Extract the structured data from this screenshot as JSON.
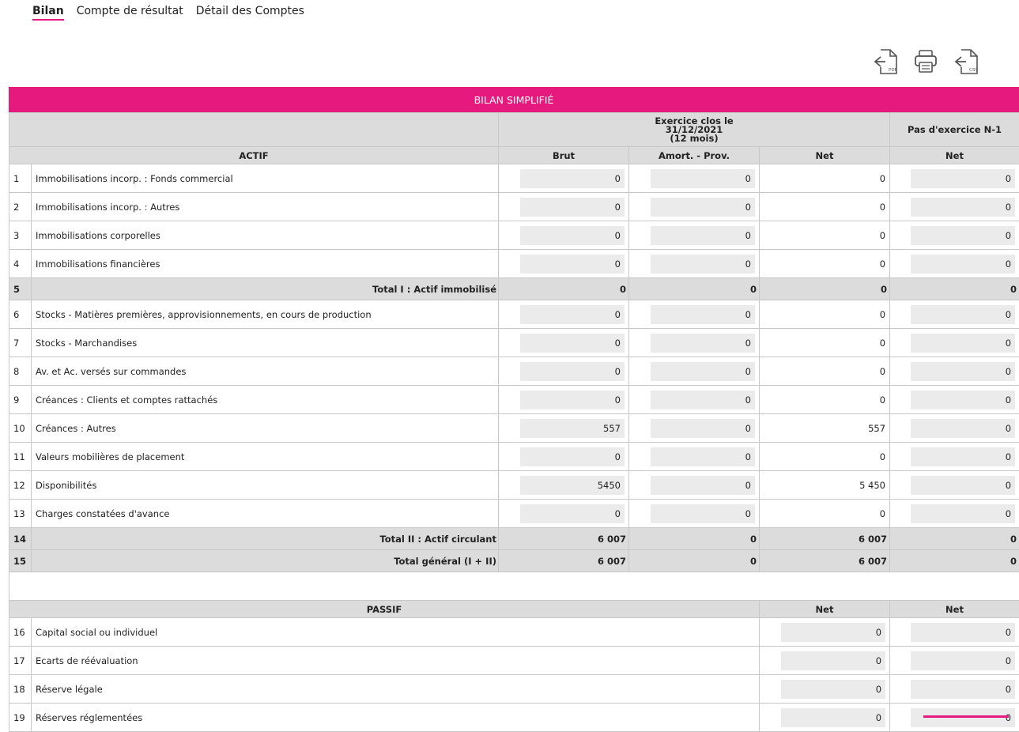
{
  "tabs": [
    {
      "label": "Bilan",
      "active": true
    },
    {
      "label": "Compte de résultat",
      "active": false
    },
    {
      "label": "Détail des Comptes",
      "active": false
    }
  ],
  "actions": {
    "pdf_label": "PDF",
    "csv_label": "CSV"
  },
  "colors": {
    "accent": "#e6197e",
    "header_bg": "#dcdcdc",
    "field_bg": "#ebebeb"
  },
  "table": {
    "title": "BILAN SIMPLIFIÉ",
    "period": {
      "line1": "Exercice clos le",
      "line2": "31/12/2021",
      "line3": "(12 mois)"
    },
    "prev_period": "Pas d'exercice N-1",
    "actif_header": "ACTIF",
    "col_brut": "Brut",
    "col_amort": "Amort. - Prov.",
    "col_net": "Net",
    "col_net_prev": "Net",
    "actif_rows": [
      {
        "num": "1",
        "label": "Immobilisations incorp. : Fonds commercial",
        "brut": "0",
        "amort": "0",
        "net": "0",
        "prev": "0"
      },
      {
        "num": "2",
        "label": "Immobilisations incorp. : Autres",
        "brut": "0",
        "amort": "0",
        "net": "0",
        "prev": "0"
      },
      {
        "num": "3",
        "label": "Immobilisations corporelles",
        "brut": "0",
        "amort": "0",
        "net": "0",
        "prev": "0"
      },
      {
        "num": "4",
        "label": "Immobilisations financières",
        "brut": "0",
        "amort": "0",
        "net": "0",
        "prev": "0"
      },
      {
        "num": "5",
        "label": "Total I : Actif immobilisé",
        "brut": "0",
        "amort": "0",
        "net": "0",
        "prev": "0",
        "total": true
      },
      {
        "num": "6",
        "label": "Stocks - Matières premières, approvisionnements, en cours de production",
        "brut": "0",
        "amort": "0",
        "net": "0",
        "prev": "0"
      },
      {
        "num": "7",
        "label": "Stocks - Marchandises",
        "brut": "0",
        "amort": "0",
        "net": "0",
        "prev": "0"
      },
      {
        "num": "8",
        "label": "Av. et Ac. versés sur commandes",
        "brut": "0",
        "amort": "0",
        "net": "0",
        "prev": "0"
      },
      {
        "num": "9",
        "label": "Créances : Clients et comptes rattachés",
        "brut": "0",
        "amort": "0",
        "net": "0",
        "prev": "0"
      },
      {
        "num": "10",
        "label": "Créances : Autres",
        "brut": "557",
        "amort": "0",
        "net": "557",
        "prev": "0"
      },
      {
        "num": "11",
        "label": "Valeurs mobilières de placement",
        "brut": "0",
        "amort": "0",
        "net": "0",
        "prev": "0"
      },
      {
        "num": "12",
        "label": "Disponibilités",
        "brut": "5450",
        "amort": "0",
        "net": "5 450",
        "prev": "0"
      },
      {
        "num": "13",
        "label": "Charges constatées d'avance",
        "brut": "0",
        "amort": "0",
        "net": "0",
        "prev": "0"
      },
      {
        "num": "14",
        "label": "Total II : Actif circulant",
        "brut": "6 007",
        "amort": "0",
        "net": "6 007",
        "prev": "0",
        "total": true
      },
      {
        "num": "15",
        "label": "Total général (I + II)",
        "brut": "6 007",
        "amort": "0",
        "net": "6 007",
        "prev": "0",
        "total": true
      }
    ],
    "passif_header": "PASSIF",
    "passif_col_net": "Net",
    "passif_col_net_prev": "Net",
    "passif_rows": [
      {
        "num": "16",
        "label": "Capital social ou individuel",
        "net": "0",
        "prev": "0"
      },
      {
        "num": "17",
        "label": "Ecarts de réévaluation",
        "net": "0",
        "prev": "0"
      },
      {
        "num": "18",
        "label": "Réserve légale",
        "net": "0",
        "prev": "0"
      },
      {
        "num": "19",
        "label": "Réserves réglementées",
        "net": "0",
        "prev": "0"
      }
    ]
  }
}
